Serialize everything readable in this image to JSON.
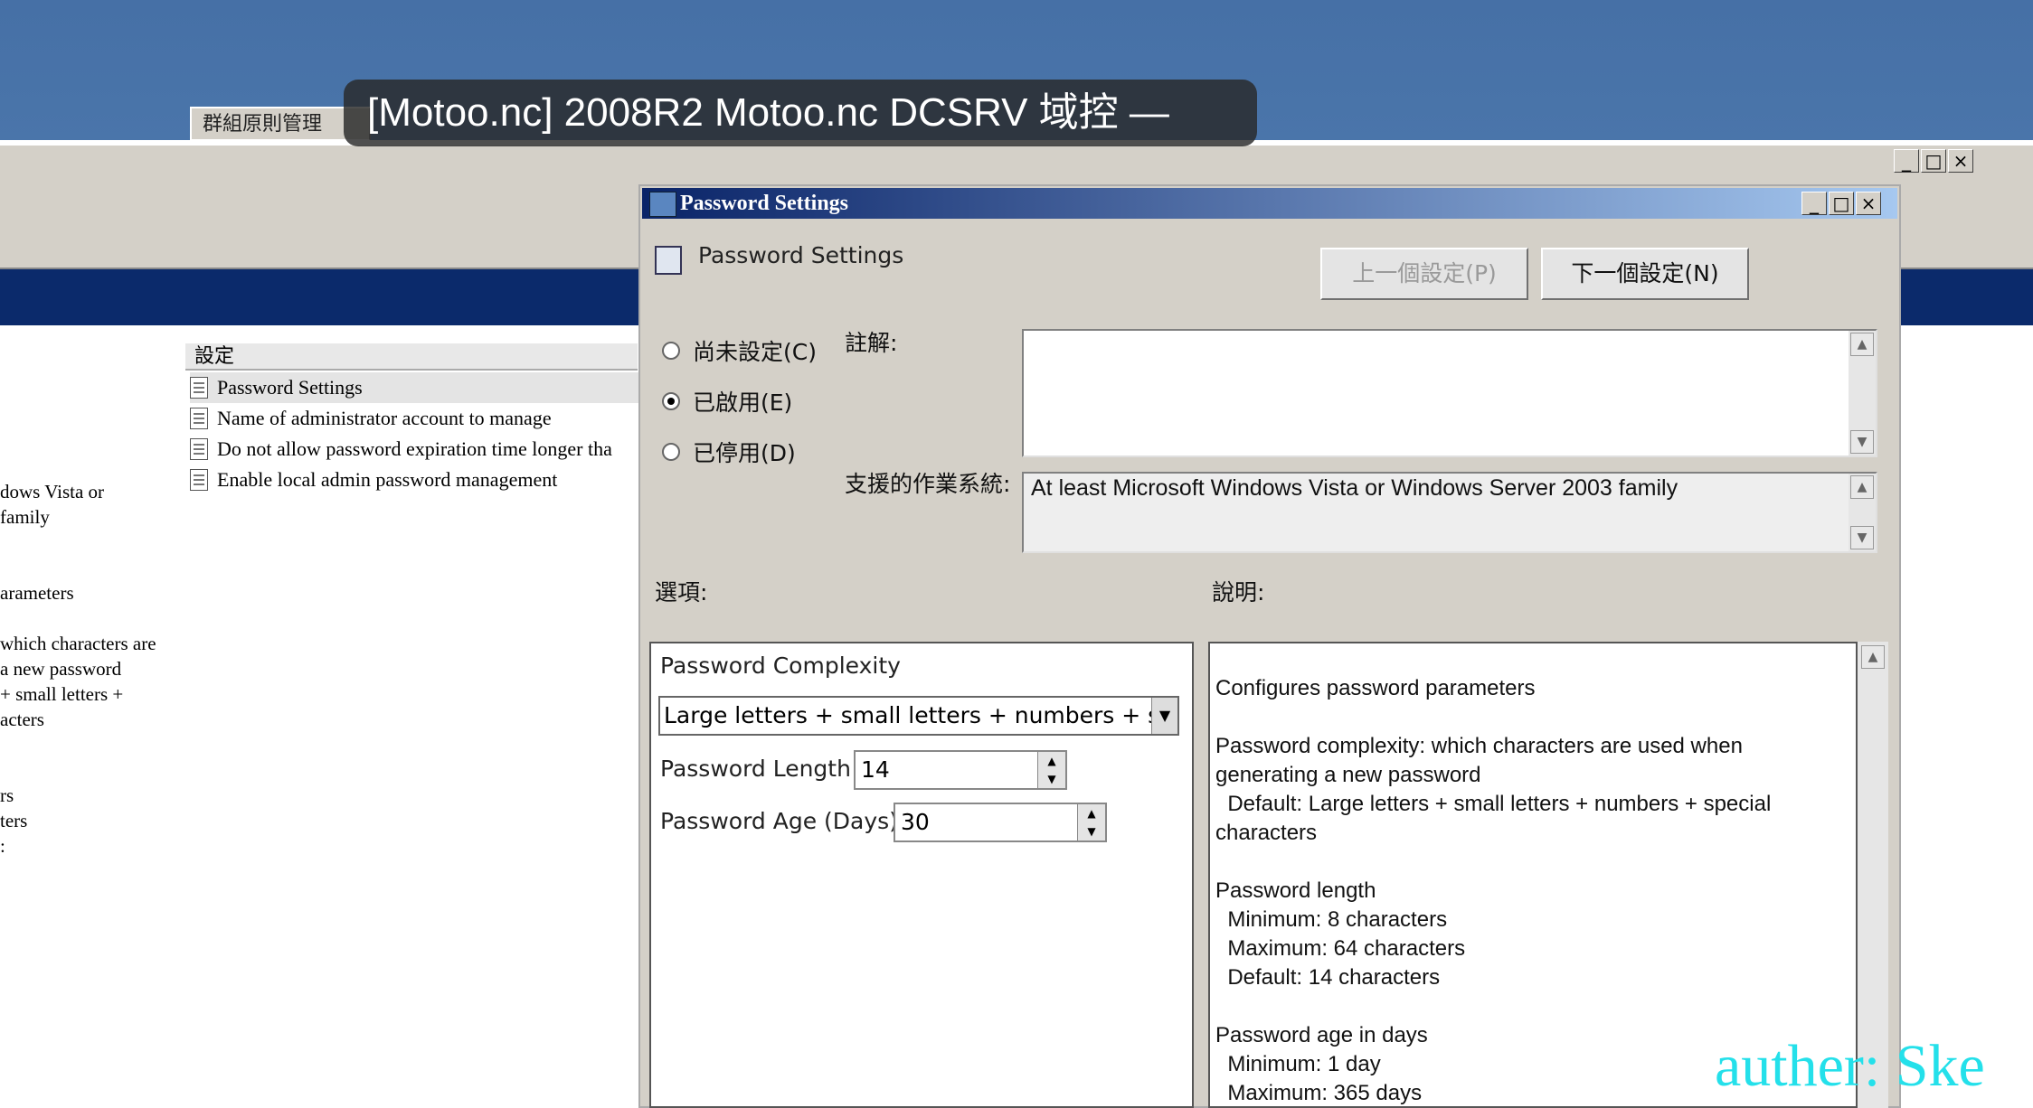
{
  "overlay": {
    "title": "[Motoo.nc] 2008R2 Motoo.nc DCSRV 域控 —"
  },
  "background_window": {
    "tab_label": "群組原則管理",
    "settings_header": "設定",
    "settings": [
      "Password Settings",
      "Name of administrator account to manage",
      "Do not allow password expiration time longer tha",
      "Enable local admin password management"
    ],
    "left_fragments": [
      "dows Vista or",
      "family",
      "",
      "",
      "arameters",
      "",
      "which characters are",
      "a new password",
      "+ small letters +",
      "acters",
      "",
      "",
      "rs",
      "ters",
      ":"
    ]
  },
  "dialog": {
    "title": "Password Settings",
    "heading": "Password Settings",
    "prev_button": "上一個設定(P)",
    "next_button": "下一個設定(N)",
    "radios": {
      "not_configured": "尚未設定(C)",
      "enabled": "已啟用(E)",
      "disabled": "已停用(D)",
      "selected": "enabled"
    },
    "comment_label": "註解:",
    "comment_value": "",
    "supported_label": "支援的作業系統:",
    "supported_value": "At least Microsoft Windows Vista or Windows Server 2003 family",
    "options_label": "選項:",
    "help_label": "說明:",
    "options": {
      "complexity_label": "Password Complexity",
      "complexity_value": "Large letters + small letters + numbers + special",
      "length_label": "Password Length",
      "length_value": "14",
      "age_label": "Password Age (Days)",
      "age_value": "30"
    },
    "help_text": "Configures password parameters\n\nPassword complexity: which characters are used when\ngenerating a new password\n  Default: Large letters + small letters + numbers + special\ncharacters\n\nPassword length\n  Minimum: 8 characters\n  Maximum: 64 characters\n  Default: 14 characters\n\nPassword age in days\n  Minimum: 1 day\n  Maximum: 365 days"
  },
  "watermark": "auther: Ske",
  "colors": {
    "desktop": "#4a72a6",
    "banner": "#0b2a6b",
    "watermark": "#24e0ea"
  }
}
